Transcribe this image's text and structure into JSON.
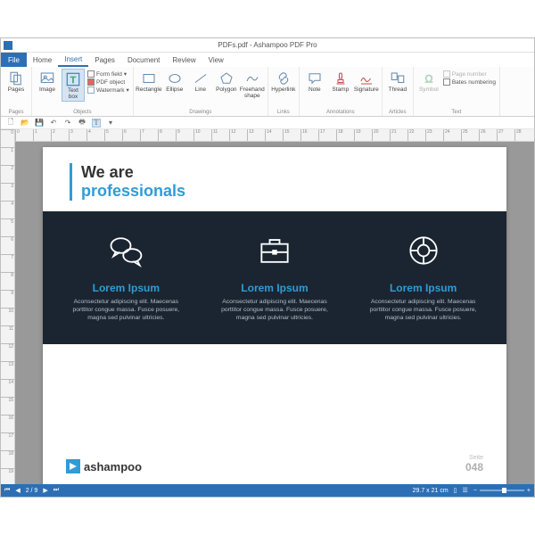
{
  "title": "PDFs.pdf - Ashampoo PDF Pro",
  "menu": {
    "file": "File",
    "tabs": [
      "Home",
      "Insert",
      "Pages",
      "Document",
      "Review",
      "View"
    ],
    "active": "Insert"
  },
  "ribbon": {
    "pages": {
      "btn": "Pages",
      "group": "Pages"
    },
    "objects": {
      "image": "Image",
      "textbox": "Text\nbox",
      "formfield": "Form field",
      "pdfobject": "PDF object",
      "watermark": "Watermark",
      "group": "Objects"
    },
    "drawings": {
      "rectangle": "Rectangle",
      "ellipse": "Ellipse",
      "line": "Line",
      "polygon": "Polygon",
      "freehand": "Freehand\nshape",
      "group": "Drawings"
    },
    "links": {
      "hyperlink": "Hyperlink",
      "group": "Links"
    },
    "annotations": {
      "note": "Note",
      "stamp": "Stamp",
      "signature": "Signature",
      "group": "Annotations"
    },
    "articles": {
      "thread": "Thread",
      "group": "Articles"
    },
    "text": {
      "symbol": "Symbol",
      "pagenumber": "Page number",
      "bates": "Bates numbering",
      "group": "Text"
    }
  },
  "doc": {
    "head_l1": "We are",
    "head_l2": "professionals",
    "cols": [
      {
        "title": "Lorem Ipsum",
        "body": "Aconsectetur adipiscing elit. Maecenas porttitor congue massa. Fusce posuere, magna sed pulvinar ultricies."
      },
      {
        "title": "Lorem Ipsum",
        "body": "Aconsectetur adipiscing elit. Maecenas porttitor congue massa. Fusce posuere, magna sed pulvinar ultricies."
      },
      {
        "title": "Lorem Ipsum",
        "body": "Aconsectetur adipiscing elit. Maecenas porttitor congue massa. Fusce posuere, magna sed pulvinar ultricies."
      }
    ],
    "brand": "ashampoo",
    "page_word": "Seite",
    "page_num": "048"
  },
  "status": {
    "page": "2 / 9",
    "dims": "29.7 x 21 cm"
  }
}
